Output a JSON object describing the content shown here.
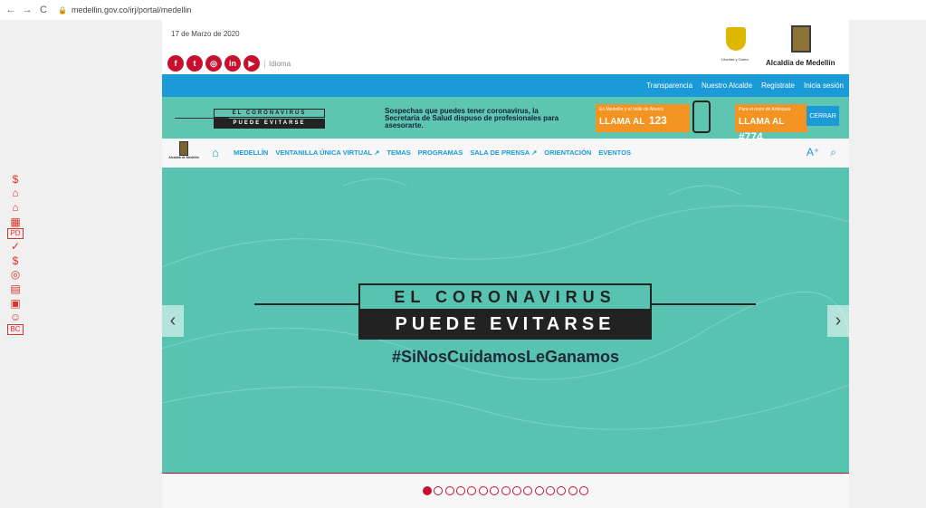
{
  "browser": {
    "url": "medellin.gov.co/irj/portal/medellin"
  },
  "header": {
    "date": "17 de Marzo de 2020",
    "idioma": "Idioma",
    "shield_caption": "Libertad y Orden",
    "alcaldia": "Alcaldía de Medellín",
    "socials": [
      "facebook-icon",
      "twitter-icon",
      "instagram-icon",
      "linkedin-icon",
      "youtube-icon"
    ]
  },
  "topnav": [
    "Transparencia",
    "Nuestro Alcalde",
    "Regístrate",
    "Inicia sesión"
  ],
  "banner": {
    "line1": "EL CORONAVIRUS",
    "line2": "PUEDE EVITARSE",
    "text": "Sospechas que puedes tener coronavirus, la Secretaría de Salud dispuso de profesionales para asesorarte.",
    "call1_small": "En Medellín y el Valle de Aburrá",
    "call1_big": "LLAMA AL",
    "call1_num": "123",
    "call2_small": "Para el resto de Antioquia",
    "call2_big": "LLAMA AL",
    "call2_num": "#774",
    "close": "CERRAR"
  },
  "nav": {
    "logo_text": "Alcaldía de Medellín",
    "items": [
      "MEDELLÍN",
      "VENTANILLA ÚNICA VIRTUAL ↗",
      "TEMAS",
      "PROGRAMAS",
      "SALA DE PRENSA ↗",
      "ORIENTACIÓN",
      "EVENTOS"
    ]
  },
  "hero": {
    "line1": "EL CORONAVIRUS",
    "line2": "PUEDE EVITARSE",
    "hashtag": "#SiNosCuidamosLeGanamos"
  },
  "carousel": {
    "total": 15,
    "active": 0
  }
}
